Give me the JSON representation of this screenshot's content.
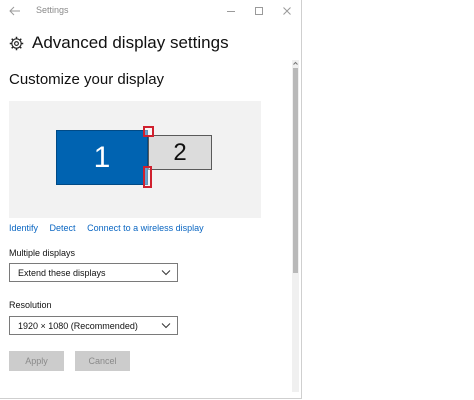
{
  "window": {
    "title": "Settings"
  },
  "header": {
    "title": "Advanced display settings",
    "icon": "gear-icon"
  },
  "section": {
    "title": "Customize your display"
  },
  "preview": {
    "monitors": [
      {
        "label": "1",
        "selected": true,
        "color": "#0063b1"
      },
      {
        "label": "2",
        "selected": false,
        "color": "#dcdcdc"
      }
    ],
    "handle_color": "#d0202e"
  },
  "links": [
    "Identify",
    "Detect",
    "Connect to a wireless display"
  ],
  "multiple_displays": {
    "label": "Multiple displays",
    "value": "Extend these displays"
  },
  "resolution": {
    "label": "Resolution",
    "value": "1920 × 1080 (Recommended)"
  },
  "buttons": {
    "apply": "Apply",
    "cancel": "Cancel"
  },
  "colors": {
    "accent": "#0063b1",
    "link": "#0a66c2",
    "disabled_button": "#cccccc"
  }
}
